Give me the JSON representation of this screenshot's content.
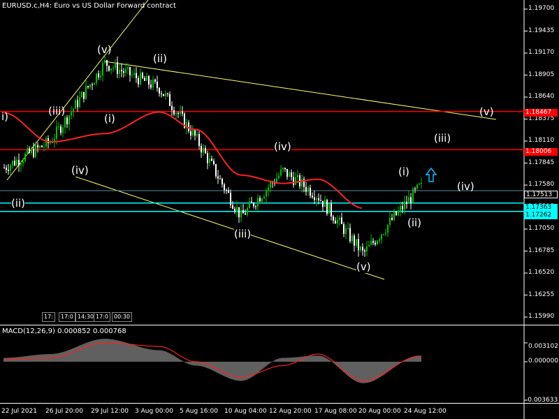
{
  "window": {
    "title": "EURUSD.c,H4:  Euro vs US Dollar Forward contract"
  },
  "colors": {
    "background": "#000000",
    "candle_up": "#00c000",
    "candle_down": "#ffffff",
    "ma": "#ff2020",
    "horizontal_red": "#ff0000",
    "horizontal_cyan": "#00ffff",
    "trendline": "#ffff60",
    "macd_hist": "#c0c0c0",
    "macd_signal": "#ff2020",
    "arrow": "#00bfff"
  },
  "price_axis": {
    "ticks": [
      "1.19700",
      "1.19435",
      "1.19170",
      "1.18905",
      "1.18640",
      "1.18375",
      "1.18110",
      "1.17845",
      "1.17580",
      "1.17315",
      "1.17050",
      "1.16785",
      "1.16520",
      "1.16255",
      "1.15990"
    ]
  },
  "price_tags": [
    {
      "price": "1.18467",
      "color": "#ff0000"
    },
    {
      "price": "1.18006",
      "color": "#ff0000"
    },
    {
      "price": "1.17513",
      "color": "#000000"
    },
    {
      "price": "1.17363",
      "color": "#00ffff"
    },
    {
      "price": "1.17262",
      "color": "#00ffff"
    }
  ],
  "time_axis": [
    "22 Jul 2021",
    "26 Jul 20:00",
    "29 Jul 12:00",
    "3 Aug 00:00",
    "5 Aug 16:00",
    "10 Aug 04:00",
    "12 Aug 20:00",
    "17 Aug 08:00",
    "20 Aug 00:00",
    "24 Aug 12:00"
  ],
  "wave_labels": [
    "i)",
    "(iii)",
    "(v)",
    "(ii)",
    "(i)",
    "(iv)",
    "(iii)",
    "(iv)",
    "(v)",
    "(i)",
    "(ii)",
    "(iii)",
    "(iv)",
    "(v)",
    "(ii)"
  ],
  "timeframe_buttons": [
    "17:",
    "17:0",
    "14:30",
    "17:0",
    "00:30"
  ],
  "macd": {
    "title": "MACD(12,26,9) 0.000852 0.000768",
    "ticks": [
      "0.003102",
      "0.000000",
      "-0.003633"
    ]
  },
  "chart_data": [
    {
      "type": "line",
      "title": "EURUSD.c,H4:  Euro vs US Dollar Forward contract",
      "ylim": [
        1.1599,
        1.197
      ],
      "x": [
        "22 Jul 2021",
        "26 Jul 20:00",
        "29 Jul 12:00",
        "3 Aug 00:00",
        "5 Aug 16:00",
        "10 Aug 04:00",
        "12 Aug 20:00",
        "17 Aug 08:00",
        "20 Aug 00:00",
        "24 Aug 12:00"
      ],
      "series": [
        {
          "values": [
            1.1779,
            1.181,
            1.1905,
            1.1875,
            1.1815,
            1.172,
            1.1775,
            1.1745,
            1.1675,
            1.1755
          ]
        },
        {
          "values": [
            1.1845,
            1.181,
            1.182,
            1.1846,
            1.1825,
            1.177,
            1.176,
            1.1765,
            1.173,
            1.1738
          ]
        }
      ],
      "hlines": [
        1.18467,
        1.18006,
        1.17513,
        1.17363,
        1.17262
      ]
    },
    {
      "type": "bar",
      "title": "MACD(12,26,9) 0.000852 0.000768",
      "ylim": [
        -0.003633,
        0.003102
      ],
      "x": [
        "22 Jul 2021",
        "26 Jul 20:00",
        "29 Jul 12:00",
        "3 Aug 00:00",
        "5 Aug 16:00",
        "10 Aug 04:00",
        "12 Aug 20:00",
        "17 Aug 08:00",
        "20 Aug 00:00",
        "24 Aug 12:00"
      ],
      "series": [
        {
          "values": [
            0.0005,
            0.001,
            0.003,
            0.0015,
            -0.0005,
            -0.0025,
            0.0005,
            0.0008,
            -0.0028,
            0.0008
          ]
        },
        {
          "values": [
            0.0003,
            0.0005,
            0.0025,
            0.002,
            0.0,
            -0.002,
            -0.0005,
            0.001,
            -0.0025,
            0.0007
          ]
        }
      ]
    }
  ]
}
